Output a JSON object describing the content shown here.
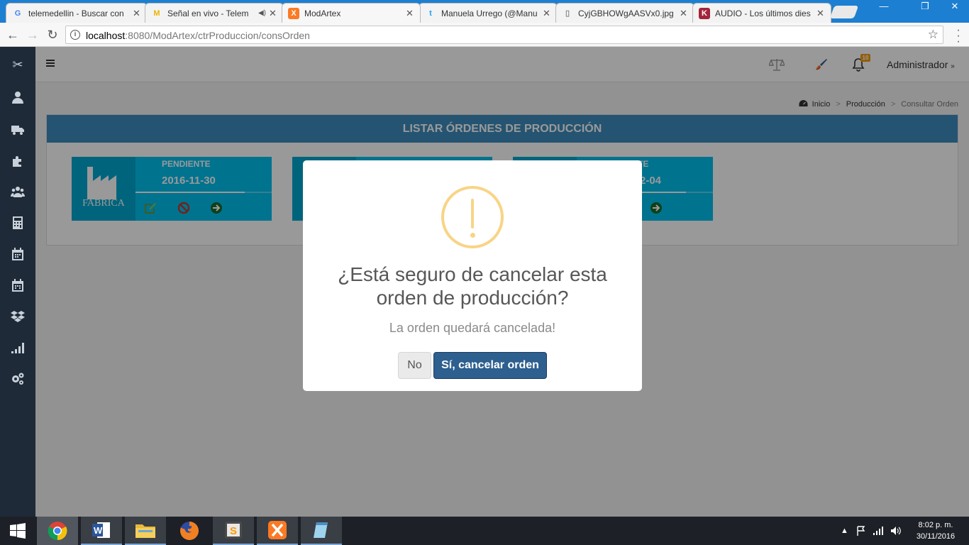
{
  "browser": {
    "tabs": [
      {
        "title": "telemedellin - Buscar con",
        "favicon": "G",
        "favicon_color": "#4285f4"
      },
      {
        "title": "Señal en vivo - Telem",
        "favicon": "M",
        "favicon_color": "#f0b400"
      },
      {
        "title": "ModArtex",
        "favicon": "X",
        "favicon_color": "#fb7a24"
      },
      {
        "title": "Manuela Urrego (@Manu",
        "favicon": "t",
        "favicon_color": "#1da1f2"
      },
      {
        "title": "CyjGBHOWgAASVx0.jpg",
        "favicon": "▯",
        "favicon_color": "#888888"
      },
      {
        "title": "AUDIO - Los últimos dies",
        "favicon": "K",
        "favicon_color": "#a4243b"
      }
    ],
    "url_host": "localhost",
    "url_path": ":8080/ModArtex/ctrProduccion/consOrden"
  },
  "sidebar": {
    "items": [
      "scissors-icon",
      "user-icon",
      "truck-icon",
      "puzzle-icon",
      "users-icon",
      "calculator-icon",
      "calendar-icon",
      "calendar-alt-icon",
      "dropbox-icon",
      "signal-icon",
      "gears-icon"
    ]
  },
  "topnav": {
    "notification_count": "10",
    "user_label": "Administrador"
  },
  "breadcrumb": {
    "home": "Inicio",
    "section": "Producción",
    "current": "Consultar Orden"
  },
  "panel": {
    "title": "LISTAR ÓRDENES DE PRODUCCIÓN",
    "cards": [
      {
        "icon_label": "FABRICA",
        "status": "PENDIENTE",
        "date": "2016-11-30",
        "progress": 0.8
      },
      {
        "icon_label": "",
        "status": "",
        "date": "",
        "progress": 0.8
      },
      {
        "icon_label": "",
        "status": "TE",
        "date": "2-04",
        "progress": 0.8
      }
    ]
  },
  "modal": {
    "title": "¿Está seguro de cancelar esta orden de producción?",
    "text": "La orden quedará cancelada!",
    "cancel_label": "No",
    "confirm_label": "Sí, cancelar orden"
  },
  "taskbar": {
    "time": "8:02 p. m.",
    "date": "30/11/2016"
  },
  "colors": {
    "accent": "#3c8dbc",
    "card": "#00c0ef",
    "confirm": "#2d5f8f",
    "warning": "#f8d486"
  }
}
